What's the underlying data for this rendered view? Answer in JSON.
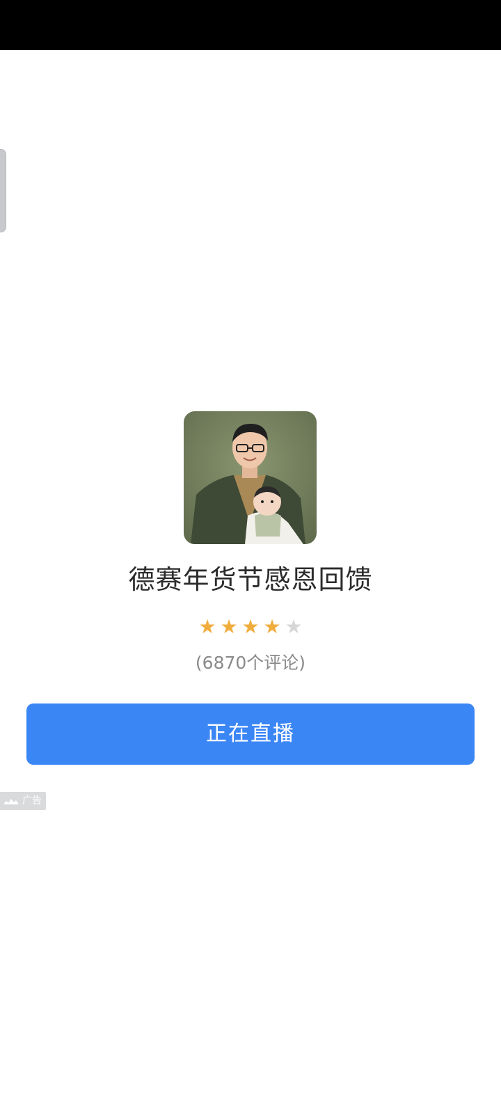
{
  "ad": {
    "title": "德赛年货节感恩回馈",
    "rating": 4,
    "rating_max": 5,
    "review_count_text": "(6870个评论)",
    "cta_label": "正在直播",
    "badge_label": "广告"
  },
  "colors": {
    "cta": "#3b86f5",
    "star_on": "#f0ad3c",
    "star_off": "#d6d6d6",
    "status_bar": "#000000"
  },
  "icons": {
    "star": "star-icon",
    "ad_logo": "cloud-logo-icon"
  }
}
